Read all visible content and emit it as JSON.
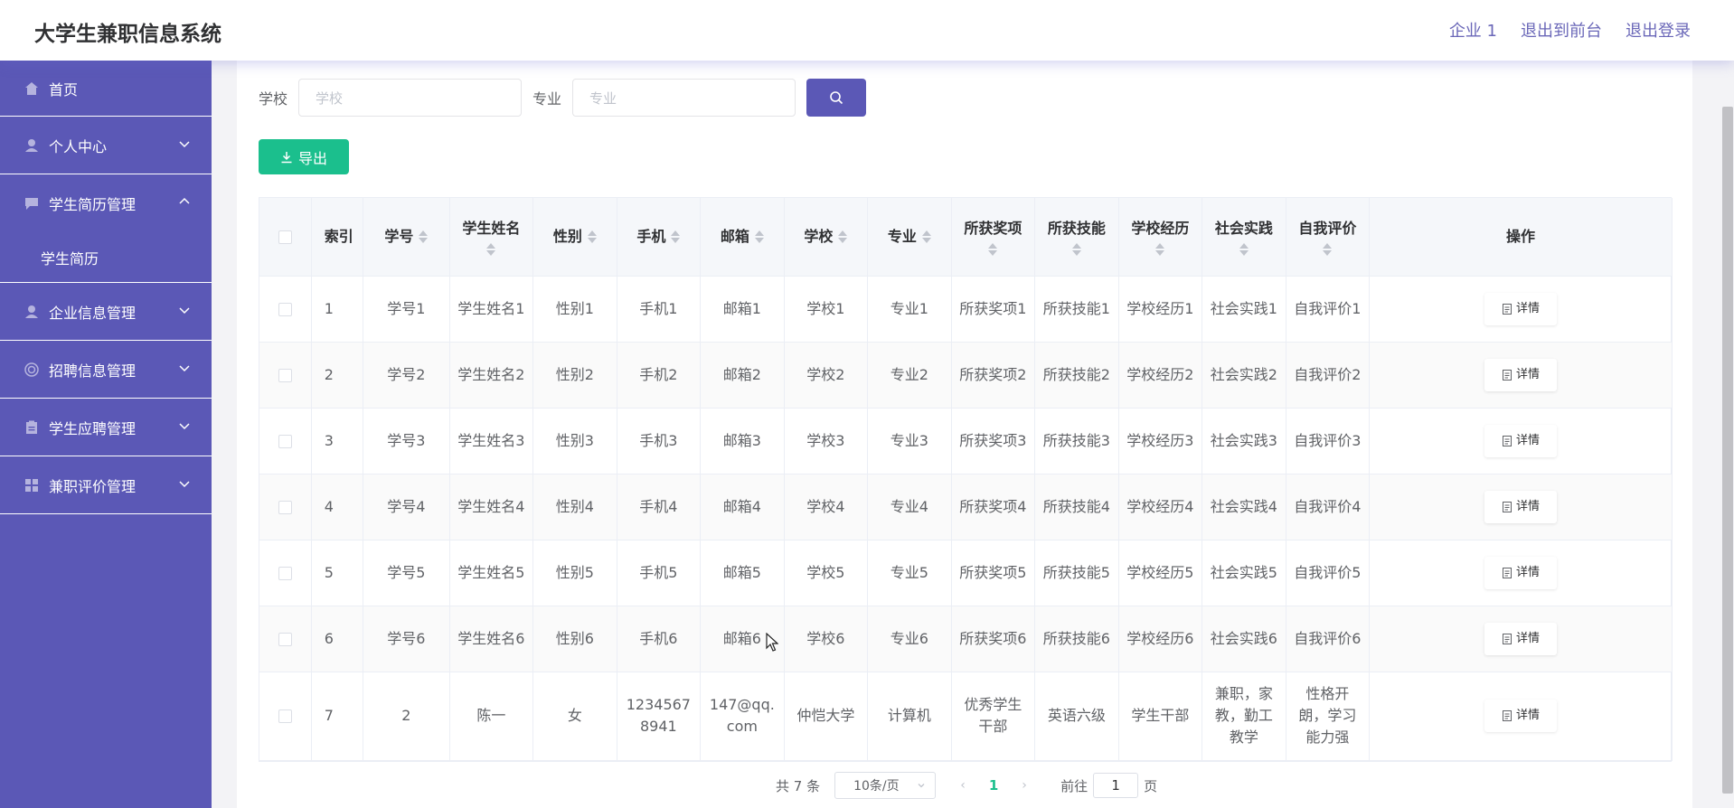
{
  "app": {
    "title": "大学生兼职信息系统"
  },
  "header": {
    "links": [
      "企业 1",
      "退出到前台",
      "退出登录"
    ]
  },
  "sidebar": {
    "items": [
      {
        "label": "首页",
        "icon": "home-icon"
      },
      {
        "label": "个人中心",
        "icon": "user-icon",
        "expandable": true
      },
      {
        "label": "学生简历管理",
        "icon": "chat-icon",
        "expandable": true,
        "expanded": true,
        "children": [
          "学生简历"
        ]
      },
      {
        "label": "企业信息管理",
        "icon": "user-icon",
        "expandable": true
      },
      {
        "label": "招聘信息管理",
        "icon": "target-icon",
        "expandable": true
      },
      {
        "label": "学生应聘管理",
        "icon": "clipboard-icon",
        "expandable": true
      },
      {
        "label": "兼职评价管理",
        "icon": "grid-icon",
        "expandable": true
      }
    ]
  },
  "search": {
    "school_label": "学校",
    "school_placeholder": "学校",
    "major_label": "专业",
    "major_placeholder": "专业"
  },
  "toolbar": {
    "export_label": "导出"
  },
  "table": {
    "columns": [
      "索引",
      "学号",
      "学生姓名",
      "性别",
      "手机",
      "邮箱",
      "学校",
      "专业",
      "所获奖项",
      "所获技能",
      "学校经历",
      "社会实践",
      "自我评价",
      "操作"
    ],
    "rows": [
      [
        "1",
        "学号1",
        "学生姓名1",
        "性别1",
        "手机1",
        "邮箱1",
        "学校1",
        "专业1",
        "所获奖项1",
        "所获技能1",
        "学校经历1",
        "社会实践1",
        "自我评价1"
      ],
      [
        "2",
        "学号2",
        "学生姓名2",
        "性别2",
        "手机2",
        "邮箱2",
        "学校2",
        "专业2",
        "所获奖项2",
        "所获技能2",
        "学校经历2",
        "社会实践2",
        "自我评价2"
      ],
      [
        "3",
        "学号3",
        "学生姓名3",
        "性别3",
        "手机3",
        "邮箱3",
        "学校3",
        "专业3",
        "所获奖项3",
        "所获技能3",
        "学校经历3",
        "社会实践3",
        "自我评价3"
      ],
      [
        "4",
        "学号4",
        "学生姓名4",
        "性别4",
        "手机4",
        "邮箱4",
        "学校4",
        "专业4",
        "所获奖项4",
        "所获技能4",
        "学校经历4",
        "社会实践4",
        "自我评价4"
      ],
      [
        "5",
        "学号5",
        "学生姓名5",
        "性别5",
        "手机5",
        "邮箱5",
        "学校5",
        "专业5",
        "所获奖项5",
        "所获技能5",
        "学校经历5",
        "社会实践5",
        "自我评价5"
      ],
      [
        "6",
        "学号6",
        "学生姓名6",
        "性别6",
        "手机6",
        "邮箱6",
        "学校6",
        "专业6",
        "所获奖项6",
        "所获技能6",
        "学校经历6",
        "社会实践6",
        "自我评价6"
      ],
      [
        "7",
        "2",
        "陈一",
        "女",
        "12345678941",
        "147@qq.com",
        "仲恺大学",
        "计算机",
        "优秀学生干部",
        "英语六级",
        "学生干部",
        "兼职，家教，勤工教学",
        "性格开朗，学习能力强"
      ]
    ],
    "detail_label": "详情"
  },
  "pagination": {
    "total_text": "共 7 条",
    "page_size": "10条/页",
    "current_page": "1",
    "goto_prefix": "前往",
    "goto_value": "1",
    "goto_suffix": "页"
  },
  "colors": {
    "sidebar": "#5b58b6",
    "accent": "#5b58b6",
    "export": "#1bbf8d"
  }
}
